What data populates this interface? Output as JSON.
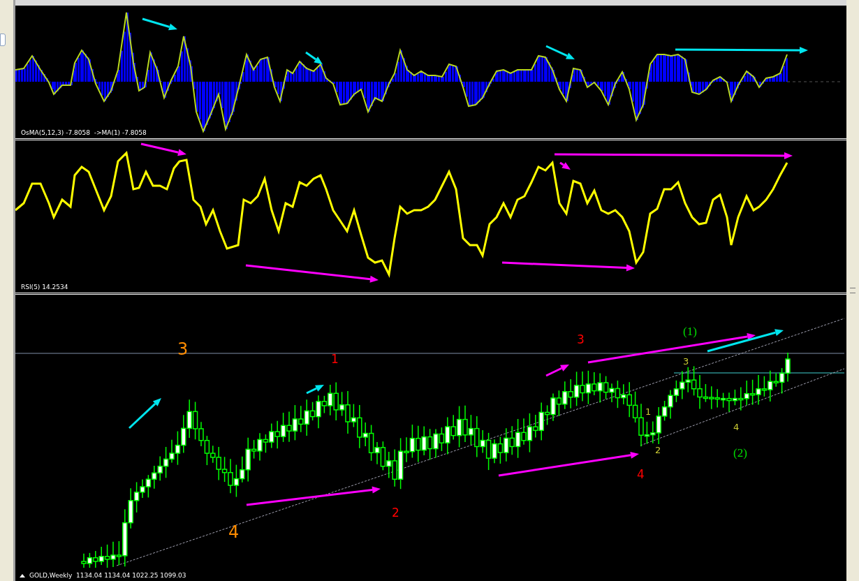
{
  "indicator_panes": [
    {
      "kind": "osma",
      "legend": "OsMA(5,12,3) -7.8058  ->MA(1) -7.8058"
    },
    {
      "kind": "rsi",
      "legend": "RSI(5) 14.2534"
    }
  ],
  "price_chart": {
    "legend": "GOLD,Weekly  1134.04 1134.04 1022.25 1099.03",
    "wave_labels": [
      {
        "text": "(1)",
        "kind": "cycle",
        "color": "#00dd00"
      },
      {
        "text": "3",
        "kind": "intermediate",
        "color": "#ff0000"
      },
      {
        "text": "3",
        "kind": "primary",
        "color": "#ff8c00"
      },
      {
        "text": "1",
        "kind": "intermediate",
        "color": "#ff0000"
      },
      {
        "text": "3",
        "kind": "minor",
        "color": "#cccc33"
      },
      {
        "text": "1",
        "kind": "minor",
        "color": "#cccc33"
      },
      {
        "text": "4",
        "kind": "minor",
        "color": "#cccc33"
      },
      {
        "text": "2",
        "kind": "minor",
        "color": "#cccc33"
      },
      {
        "text": "(2)",
        "kind": "cycle",
        "color": "#00dd00"
      },
      {
        "text": "4",
        "kind": "intermediate",
        "color": "#ff0000"
      },
      {
        "text": "2",
        "kind": "intermediate",
        "color": "#ff0000"
      },
      {
        "text": "4",
        "kind": "primary",
        "color": "#ff8c00"
      }
    ]
  }
}
